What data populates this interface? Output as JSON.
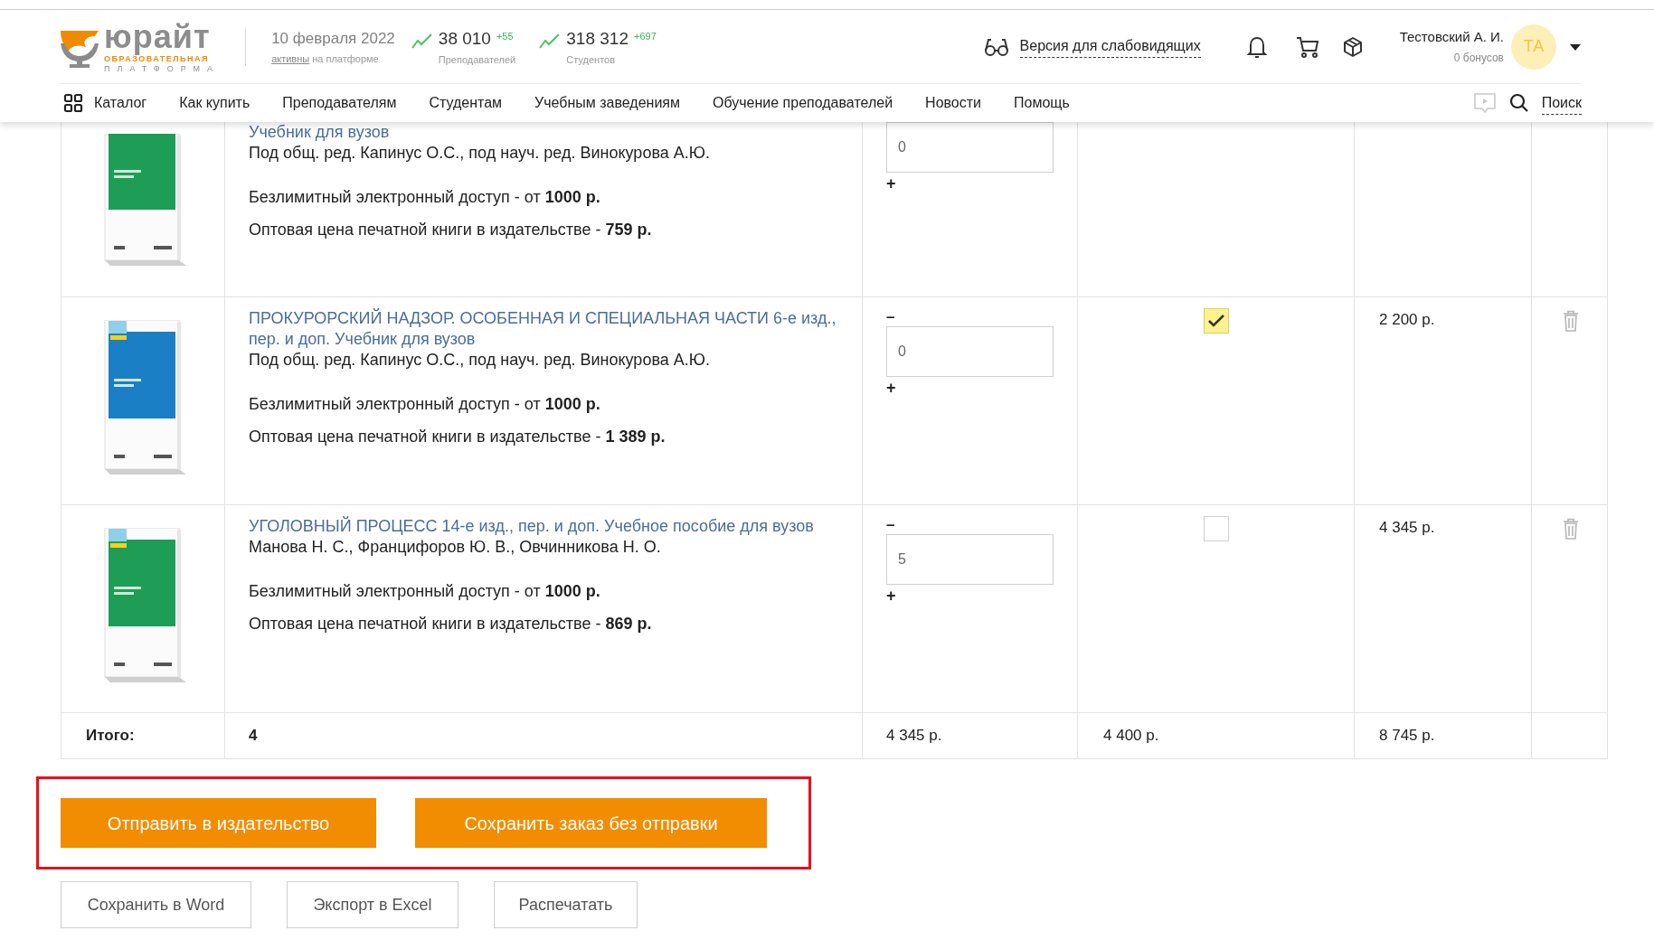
{
  "header": {
    "logo": {
      "wordmark": "юрайт",
      "tagline_1": "ОБРАЗОВАТЕЛЬНАЯ",
      "tagline_2": "ПЛАТФОРМА"
    },
    "date": "10 февраля 2022",
    "active_link": "активны",
    "active_suffix": "на платформе",
    "stats": [
      {
        "value": "38 010",
        "delta": "+55",
        "label": "Преподавателей"
      },
      {
        "value": "318 312",
        "delta": "+697",
        "label": "Студентов"
      }
    ],
    "accessibility_link": "Версия для слабовидящих",
    "user": {
      "name": "Тестовский А. И.",
      "bonus": "0 бонусов",
      "initials": "ТА"
    }
  },
  "nav": {
    "catalog": "Каталог",
    "items": [
      "Как купить",
      "Преподавателям",
      "Студентам",
      "Учебным заведениям",
      "Обучение преподавателей",
      "Новости",
      "Помощь"
    ],
    "search": "Поиск"
  },
  "table": {
    "rows": [
      {
        "title": "Учебник для вузов",
        "authors": "Под общ. ред. Капинус О.С., под науч. ред. Винокурова А.Ю.",
        "access": "Безлимитный электронный доступ - от **1000 р.**",
        "wholesale": "Оптовая цена печатной книги в издательстве - **759 р.**",
        "quantity": "0",
        "plus": "+",
        "color": "#1e9d57"
      },
      {
        "title": "ПРОКУРОРСКИЙ НАДЗОР. ОСОБЕННАЯ И СПЕЦИАЛЬНАЯ ЧАСТИ 6-е изд., пер. и доп. Учебник для вузов",
        "authors": "Под общ. ред. Капинус О.С., под науч. ред. Винокурова А.Ю.",
        "access": "Безлимитный электронный доступ - от **1000 р.**",
        "wholesale": "Оптовая цена печатной книги в издательстве - **1 389 р.**",
        "minus": "–",
        "quantity": "0",
        "plus": "+",
        "checked": true,
        "price": "2 200 р.",
        "color": "#1a7fc4"
      },
      {
        "title": "УГОЛОВНЫЙ ПРОЦЕСС 14-е изд., пер. и доп. Учебное пособие для вузов",
        "authors": "Манова Н. С., Францифоров Ю. В., Овчинникова Н. О.",
        "access": "Безлимитный электронный доступ - от **1000 р.**",
        "wholesale": "Оптовая цена печатной книги в издательстве - **869 р.**",
        "minus": "–",
        "quantity": "5",
        "plus": "+",
        "checked": false,
        "price": "4 345 р.",
        "color": "#1e9d57"
      }
    ],
    "total": {
      "label": "Итого:",
      "count": "4",
      "column_3": "4 345 р.",
      "column_4": "4 400 р.",
      "column_5": "8 745 р."
    }
  },
  "actions": {
    "primary": [
      "Отправить в издательство",
      "Сохранить заказ без отправки"
    ],
    "secondary": [
      "Сохранить в Word",
      "Экспорт в Excel",
      "Распечатать"
    ]
  }
}
